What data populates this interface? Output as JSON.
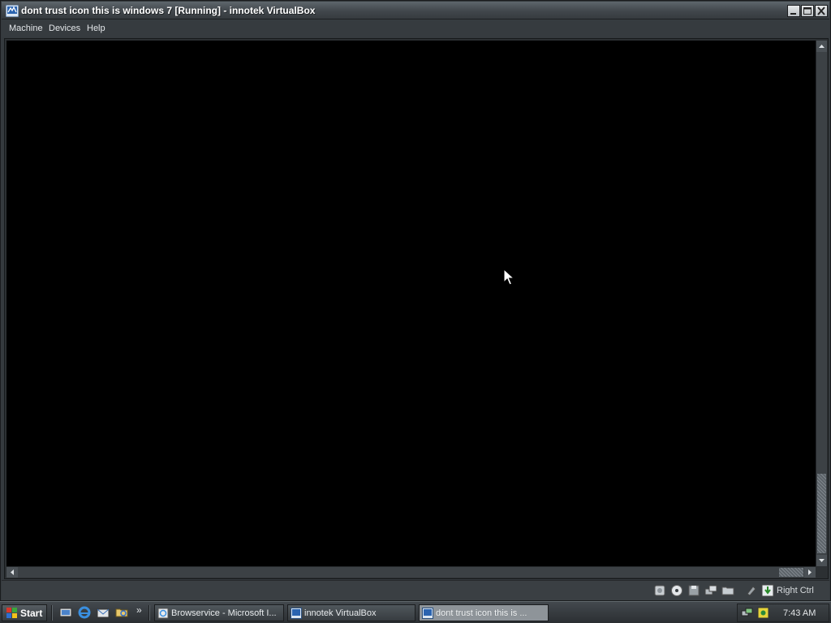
{
  "window": {
    "title": "dont trust icon this is windows 7 [Running] - innotek VirtualBox",
    "controls": [
      "minimize",
      "maximize",
      "close"
    ]
  },
  "menu": {
    "items": [
      {
        "label": "Machine"
      },
      {
        "label": "Devices"
      },
      {
        "label": "Help"
      }
    ]
  },
  "vm": {
    "screen_color": "#000000",
    "status_icons": [
      "hard-disk-icon",
      "cd-dvd-icon",
      "floppy-icon",
      "network-icon",
      "shared-folders-icon",
      "mouse-integration-icon",
      "host-key-capture-icon"
    ],
    "host_key_label": "Right Ctrl"
  },
  "taskbar": {
    "start_label": "Start",
    "quick_launch": [
      "show-desktop-icon",
      "internet-explorer-icon",
      "outlook-express-icon",
      "explorer-icon"
    ],
    "more_label": "»",
    "tasks": [
      {
        "label": "Browservice - Microsoft I...",
        "icon": "ie-page-icon",
        "active": false
      },
      {
        "label": "innotek VirtualBox",
        "icon": "virtualbox-icon",
        "active": false
      },
      {
        "label": "dont trust icon this is ...",
        "icon": "virtualbox-icon",
        "active": true
      }
    ],
    "tray_icons": [
      "network-tray-icon",
      "security-tray-icon"
    ],
    "clock": "7:43 AM"
  },
  "colors": {
    "chrome_dark": "#353a3e",
    "taskbar": "#2b2f32",
    "active_task": "#8e9499"
  }
}
